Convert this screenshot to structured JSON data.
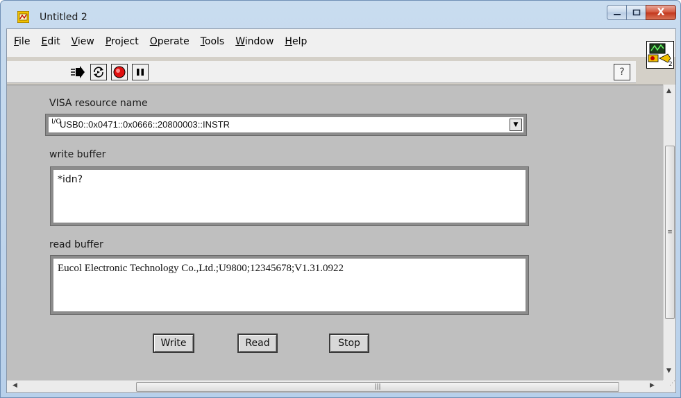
{
  "window": {
    "title": "Untitled 2",
    "close_glyph": "X"
  },
  "menu": [
    {
      "label": "File",
      "underline": "F",
      "rest": "ile"
    },
    {
      "label": "Edit",
      "underline": "E",
      "rest": "dit"
    },
    {
      "label": "View",
      "underline": "V",
      "rest": "iew"
    },
    {
      "label": "Project",
      "underline": "P",
      "rest": "roject"
    },
    {
      "label": "Operate",
      "underline": "O",
      "rest": "perate"
    },
    {
      "label": "Tools",
      "underline": "T",
      "rest": "ools"
    },
    {
      "label": "Window",
      "underline": "W",
      "rest": "indow"
    },
    {
      "label": "Help",
      "underline": "H",
      "rest": "elp"
    }
  ],
  "toolbar": {
    "help_glyph": "?",
    "vi_icon_number": "2"
  },
  "panel": {
    "visa": {
      "label": "VISA resource name",
      "glyph": "I/O",
      "value": "USB0::0x0471::0x0666::20800003::INSTR"
    },
    "write_buffer": {
      "label": "write buffer",
      "value": "*idn?"
    },
    "read_buffer": {
      "label": "read buffer",
      "value": "Eucol Electronic Technology Co.,Ltd.;U9800;12345678;V1.31.0922"
    },
    "buttons": {
      "write": "Write",
      "read": "Read",
      "stop": "Stop"
    }
  },
  "icons": {
    "run": "run-arrow-icon",
    "run_continuous": "run-continuous-icon",
    "abort": "abort-execution-icon",
    "pause": "pause-icon",
    "help": "context-help-icon"
  },
  "colors": {
    "panel_bg": "#bfbfbf",
    "abort_red": "#e01010"
  }
}
